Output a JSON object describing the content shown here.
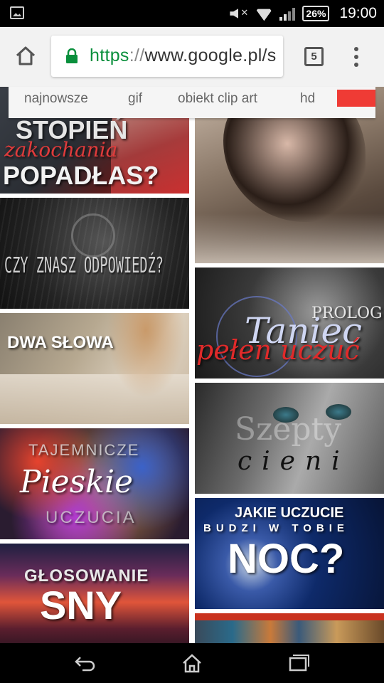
{
  "status_bar": {
    "battery": "26%",
    "time": "19:00"
  },
  "browser": {
    "url_scheme": "https",
    "url_sep": "://",
    "url_host": "www.google.pl/s",
    "tab_count": "5"
  },
  "filters": {
    "chips": [
      "najnowsze",
      "gif",
      "obiekt clip art",
      "hd"
    ],
    "accent_color": "#ef3b35"
  },
  "images": {
    "t1": {
      "line1": "STOPIEŃ",
      "line2": "zakochania",
      "line3": "POPADŁAS?"
    },
    "t3": {
      "text": "CZY ZNASZ ODPOWIEDŹ?"
    },
    "t4": {
      "line1": "PROLOG",
      "line2": "Taniec",
      "line3": "pełen uczuć"
    },
    "t5": {
      "text": "DWA SŁOWA"
    },
    "t6": {
      "line1": "Szepty",
      "line2": "cieni"
    },
    "t7": {
      "line1": "TAJEMNICZE",
      "line2": "Pieskie",
      "line3": "UCZUCIA"
    },
    "t8": {
      "line1": "JAKIE UCZUCIE",
      "line2": "BUDZI W TOBIE",
      "line3": "NOC?"
    },
    "t9": {
      "line1": "GŁOSOWANIE",
      "line2": "SNY"
    }
  },
  "icons": {
    "home": "home-icon",
    "lock": "lock-icon",
    "tabs": "tabs-icon",
    "menu": "more-vert-icon",
    "back": "back-icon",
    "nav_home": "nav-home-icon",
    "recent": "recent-apps-icon"
  }
}
